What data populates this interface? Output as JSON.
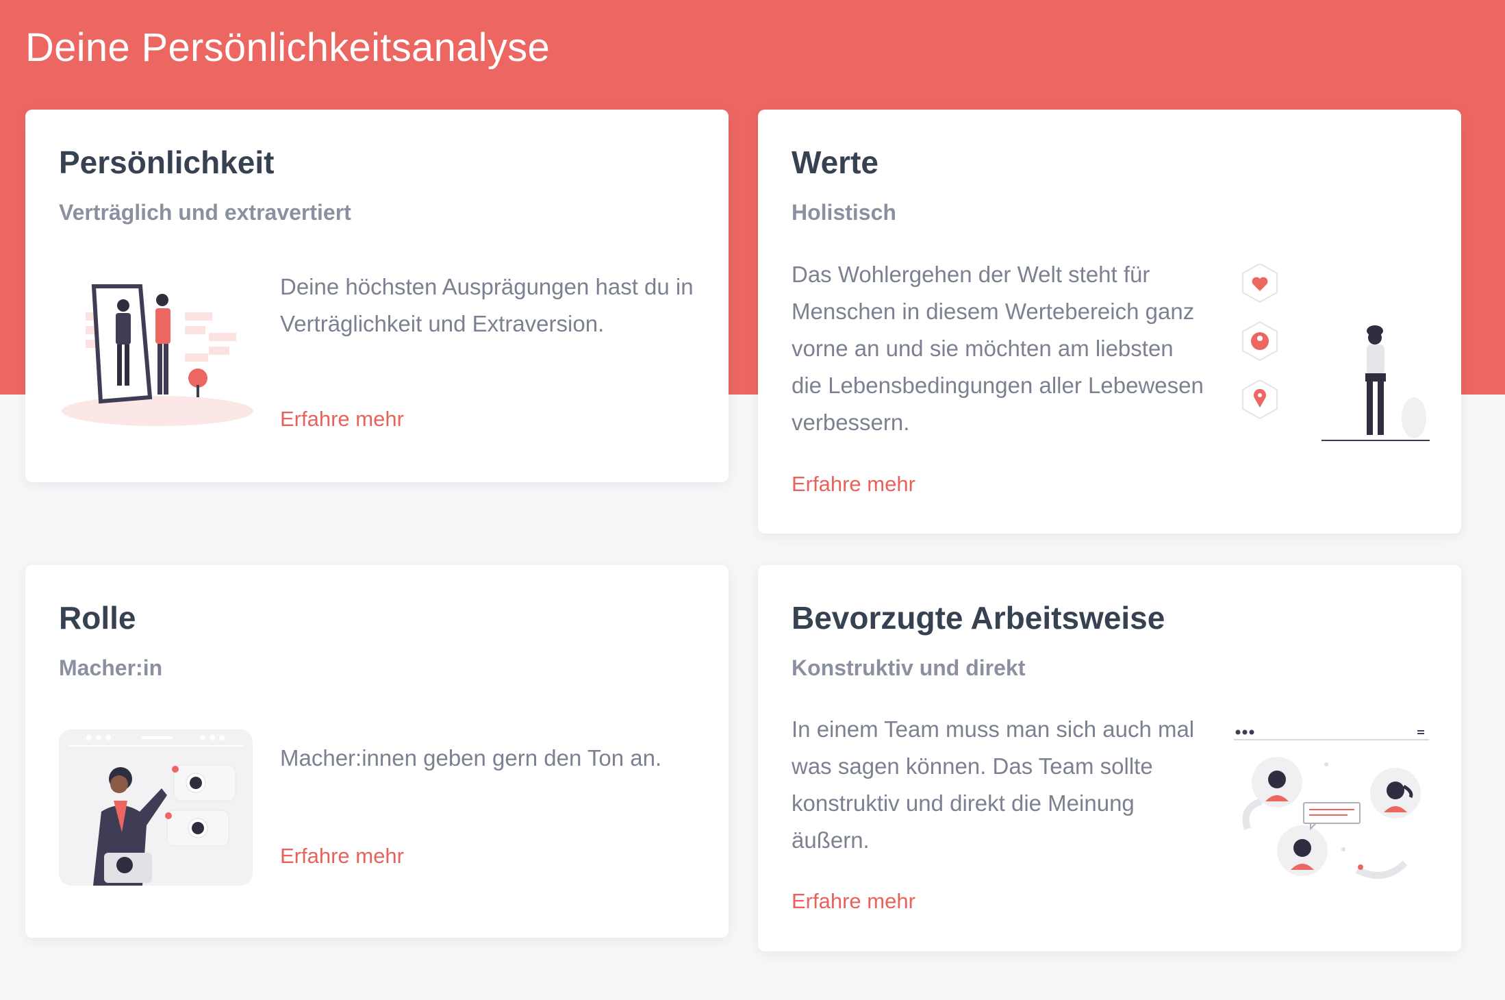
{
  "page": {
    "title": "Deine Persönlichkeitsanalyse"
  },
  "colors": {
    "accent": "#ec6762",
    "link": "#e8625c",
    "title": "#364152",
    "subtitle": "#8a90a0",
    "body_text": "#7b8191",
    "background": "#f7f7f9"
  },
  "cards": {
    "personality": {
      "title": "Persönlichkeit",
      "subtitle": "Verträglich und extravertiert",
      "text": "Deine höchsten Ausprägungen hast du in Verträglichkeit und Extraversion.",
      "link": "Erfahre mehr",
      "illustration": "mirror-illustration"
    },
    "values": {
      "title": "Werte",
      "subtitle": "Holistisch",
      "text": "Das Wohlergehen der Welt steht für Menschen in diesem Wertebereich ganz vorne an und sie möchten am liebsten die Lebensbedingungen aller Lebewesen verbessern.",
      "link": "Erfahre mehr",
      "illustration": "person-with-icons-illustration"
    },
    "role": {
      "title": "Rolle",
      "subtitle": "Macher:in",
      "text": "Macher:innen geben gern den Ton an.",
      "link": "Erfahre mehr",
      "illustration": "presenter-illustration"
    },
    "work_style": {
      "title": "Bevorzugte Arbeitsweise",
      "subtitle": "Konstruktiv und direkt",
      "text": "In einem Team muss man sich auch mal was sagen können. Das Team sollte konstruktiv und direkt die Meinung äußern.",
      "link": "Erfahre mehr",
      "illustration": "team-network-illustration"
    }
  }
}
